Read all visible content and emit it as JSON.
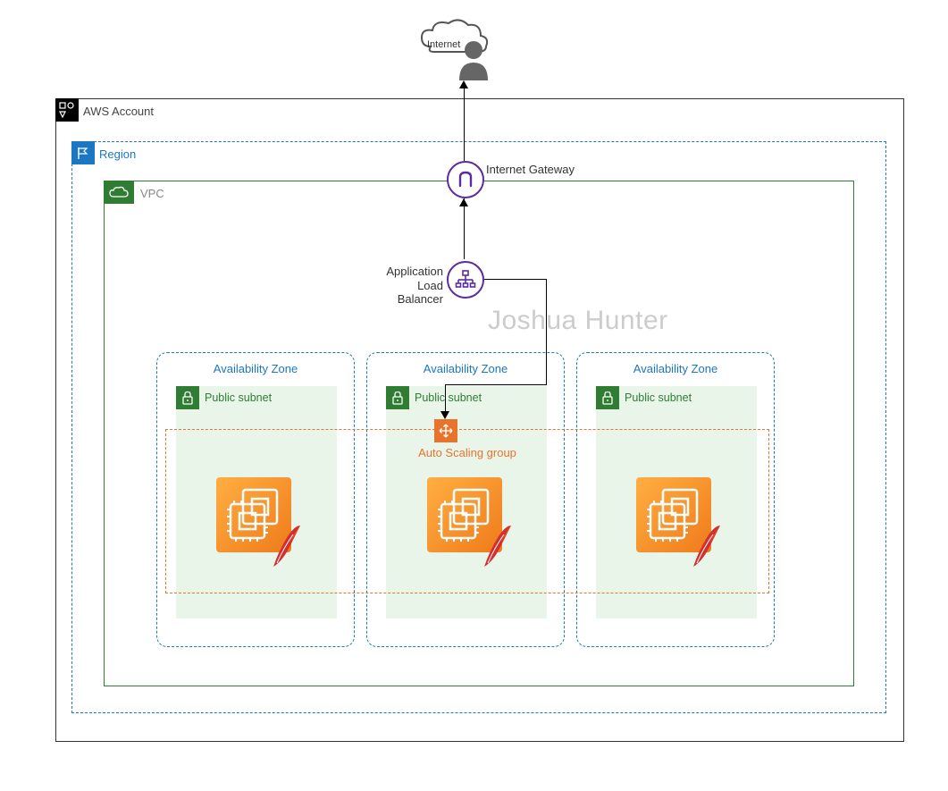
{
  "internet": {
    "label": "Internet"
  },
  "aws_account": {
    "label": "AWS Account"
  },
  "region": {
    "label": "Region"
  },
  "vpc": {
    "label": "VPC"
  },
  "igw": {
    "label": "Internet Gateway"
  },
  "alb": {
    "label_line1": "Application",
    "label_line2": "Load Balancer"
  },
  "asg": {
    "label": "Auto Scaling group"
  },
  "az": {
    "label": "Availability Zone"
  },
  "subnet": {
    "label": "Public subnet"
  },
  "watermark": "Joshua Hunter",
  "colors": {
    "region_blue": "#1c77c3",
    "vpc_green": "#2e7d32",
    "asg_orange": "#e8742c",
    "aws_purple": "#5a2ca0",
    "ec2_orange_light": "#ffae42",
    "ec2_orange_dark": "#ef7b1b"
  },
  "icons": {
    "aws_account": "account-shapes-icon",
    "region": "flag-icon",
    "vpc": "cloud-icon",
    "subnet": "lock-icon",
    "igw": "gateway-icon",
    "alb": "load-balancer-icon",
    "asg": "autoscaling-icon",
    "ec2": "ec2-instance-icon",
    "feather": "apache-feather-icon",
    "internet": "internet-user-icon"
  },
  "az_count": 3
}
